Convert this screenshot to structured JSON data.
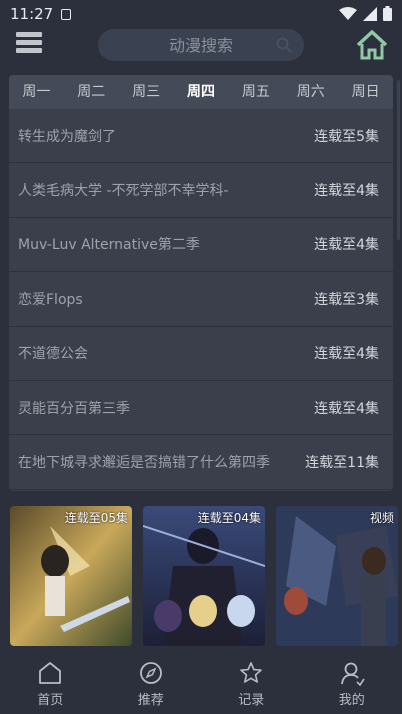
{
  "status_bar": {
    "time": "11:27"
  },
  "header": {
    "search_placeholder": "动漫搜索"
  },
  "weekdays": {
    "tabs": [
      "周一",
      "周二",
      "周三",
      "周四",
      "周五",
      "周六",
      "周日"
    ],
    "active_index": 3
  },
  "schedule": [
    {
      "title": "转生成为魔剑了",
      "episode": "连载至5集"
    },
    {
      "title": "人类毛病大学 -不死学部不幸学科-",
      "episode": "连载至4集"
    },
    {
      "title": "Muv-Luv Alternative第二季",
      "episode": "连载至4集"
    },
    {
      "title": "恋爱Flops",
      "episode": "连载至3集"
    },
    {
      "title": "不道德公会",
      "episode": "连载至4集"
    },
    {
      "title": "灵能百分百第三季",
      "episode": "连载至4集"
    },
    {
      "title": "在地下城寻求邂逅是否搞错了什么第四季",
      "episode": "连载至11集"
    }
  ],
  "posters": [
    {
      "badge": "连载至05集"
    },
    {
      "badge": "连载至04集"
    },
    {
      "badge": "视频"
    }
  ],
  "bottom_nav": [
    {
      "label": "首页",
      "icon": "home-icon"
    },
    {
      "label": "推荐",
      "icon": "compass-icon"
    },
    {
      "label": "记录",
      "icon": "star-icon"
    },
    {
      "label": "我的",
      "icon": "user-icon"
    }
  ],
  "colors": {
    "background": "#2b303c",
    "card": "#3a3f4b",
    "tab_bar": "#444a57",
    "home_icon": "#8fc9a6"
  }
}
